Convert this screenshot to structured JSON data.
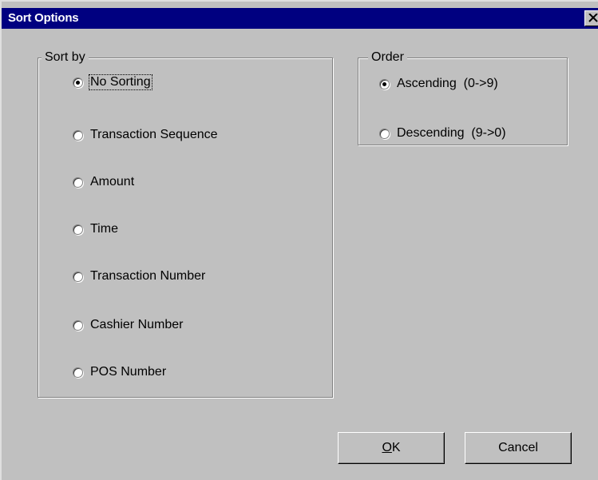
{
  "dialog": {
    "title": "Sort Options",
    "close_label": "×"
  },
  "sort_by": {
    "legend": "Sort by",
    "options": [
      {
        "label": "No Sorting",
        "checked": true
      },
      {
        "label": "Transaction Sequence",
        "checked": false
      },
      {
        "label": "Amount",
        "checked": false
      },
      {
        "label": "Time",
        "checked": false
      },
      {
        "label": "Transaction Number",
        "checked": false
      },
      {
        "label": "Cashier Number",
        "checked": false
      },
      {
        "label": "POS Number",
        "checked": false
      }
    ]
  },
  "order": {
    "legend": "Order",
    "options": [
      {
        "label": "Ascending  (0->9)",
        "checked": true
      },
      {
        "label": "Descending  (9->0)",
        "checked": false
      }
    ]
  },
  "buttons": {
    "ok_accel": "O",
    "ok_rest": "K",
    "cancel_label": "Cancel"
  }
}
